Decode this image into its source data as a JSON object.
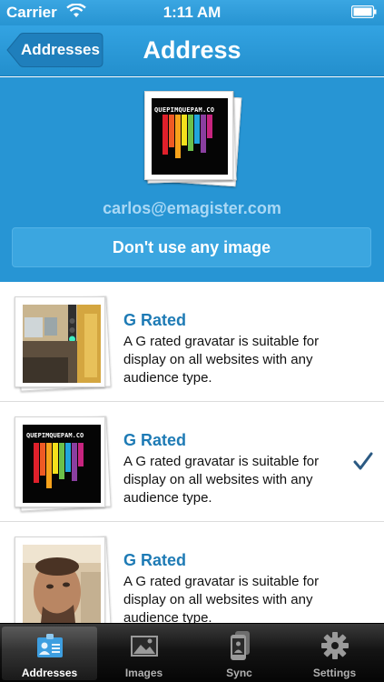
{
  "status_bar": {
    "carrier": "Carrier",
    "time": "1:11 AM"
  },
  "nav": {
    "back_label": "Addresses",
    "title": "Address"
  },
  "header": {
    "avatar_logo_text": "QUEPIMQUEPAM.CO",
    "email": "carlos@emagister.com",
    "no_image_button": "Don't use any image"
  },
  "rows": [
    {
      "title": "G Rated",
      "description": "A G rated gravatar is suitable for display on all websites with any audience type.",
      "image": "traffic-light-photo",
      "selected": false
    },
    {
      "title": "G Rated",
      "description": "A G rated gravatar is suitable for display on all websites with any audience type.",
      "image": "quepimquepam-logo",
      "logo_text": "QUEPIMQUEPAM.CO",
      "selected": true
    },
    {
      "title": "G Rated",
      "description": "A G rated gravatar is suitable for display on all websites with any audience type.",
      "image": "face-photo",
      "selected": false
    }
  ],
  "tabs": [
    {
      "label": "Addresses",
      "icon": "address-card-icon",
      "selected": true
    },
    {
      "label": "Images",
      "icon": "image-icon",
      "selected": false
    },
    {
      "label": "Sync",
      "icon": "phone-sync-icon",
      "selected": false
    },
    {
      "label": "Settings",
      "icon": "gear-icon",
      "selected": false
    }
  ],
  "colors": {
    "accent": "#2795d4",
    "row_title": "#1e7bb5",
    "checkmark": "#2b5a83"
  }
}
